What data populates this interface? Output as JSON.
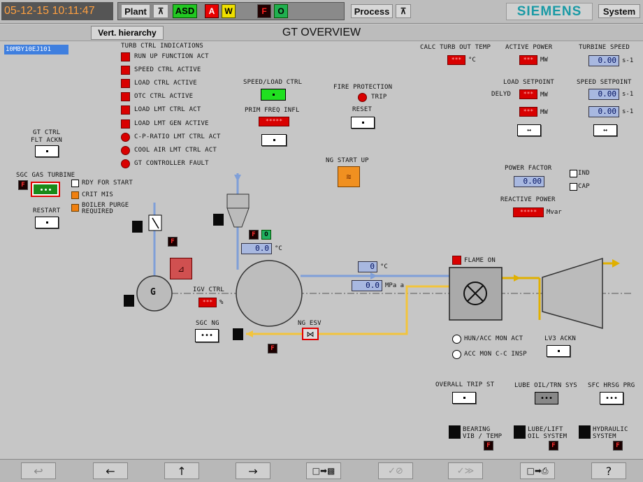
{
  "header": {
    "datetime": "05-12-15 10:11:47",
    "plant": "Plant",
    "asd": "ASD",
    "alarm_a": "A",
    "alarm_w": "W",
    "flag_f": "F",
    "flag_o": "O",
    "process": "Process",
    "brand": "SIEMENS",
    "system": "System"
  },
  "subheader": {
    "vert_hierarchy": "Vert. hierarchy",
    "title": "GT OVERVIEW"
  },
  "tag": "10MBY10EJ101",
  "turb_ctrl": {
    "title": "TURB CTRL INDICATIONS",
    "items": [
      "RUN UP FUNCTION ACT",
      "SPEED CTRL ACTIVE",
      "LOAD CTRL ACTIVE",
      "OTC CTRL ACTIVE",
      "LOAD LMT CTRL ACT",
      "LOAD LMT GEN ACTIVE",
      "C-P-RATIO LMT CTRL ACT",
      "COOL AIR LMT CTRL ACT",
      "GT CONTROLLER FAULT"
    ]
  },
  "gt_ctrl": {
    "line1": "GT CTRL",
    "line2": "FLT ACKN"
  },
  "sgc_gas": {
    "title": "SGC GAS TURBINE",
    "rdy": "RDY FOR START",
    "crit": "CRIT MIS",
    "boiler1": "BOILER PURGE",
    "boiler2": "REQUIRED",
    "restart": "RESTART",
    "f": "F"
  },
  "speed_load": {
    "label": "SPEED/LOAD CTRL",
    "prim": "PRIM FREQ INFL",
    "prim_val": "*****"
  },
  "fire": {
    "label": "FIRE PROTECTION",
    "trip": "TRIP",
    "reset": "RESET"
  },
  "ng_start": {
    "label": "NG START UP"
  },
  "top_right": {
    "calc_label": "CALC TURB OUT TEMP",
    "calc_val": "***",
    "calc_unit": "°C",
    "active_label": "ACTIVE POWER",
    "active_val": "***",
    "active_unit": "MW",
    "speed_label": "TURBINE SPEED",
    "speed_val": "0.00",
    "speed_unit": "s-1",
    "load_sp_label": "LOAD SETPOINT",
    "delyd": "DELYD",
    "load_sp1": "***",
    "load_sp2": "***",
    "mw": "MW",
    "speed_sp_label": "SPEED SETPOINT",
    "speed_sp1": "0.00",
    "speed_sp2": "0.00",
    "s1": "s-1",
    "pf_label": "POWER FACTOR",
    "pf_val": "0.00",
    "ind": "IND",
    "cap": "CAP",
    "react_label": "REACTIVE POWER",
    "react_val": "*****",
    "react_unit": "Mvar"
  },
  "process": {
    "gen": "G",
    "igv": "IGV CTRL",
    "igv_val": "***",
    "igv_unit": "%",
    "comp_temp": "0.0",
    "comp_temp_unit": "°C",
    "air_temp": "0",
    "air_temp_unit": "°C",
    "press": "0.0",
    "press_unit": "MPa a",
    "flame_on": "FLAME ON",
    "sgc_ng": "SGC NG",
    "ng_esv": "NG ESV",
    "f": "F",
    "o": "O"
  },
  "lower_right": {
    "hun": "HUN/ACC MON ACT",
    "acc": "ACC MON C-C INSP",
    "lv3": "LV3 ACKN",
    "overall": "OVERALL TRIP ST",
    "lube": "LUBE OIL/TRN SYS",
    "sfc": "SFC HRSG PRG",
    "bearing1": "BEARING",
    "bearing2": "VIB / TEMP",
    "lube_lift1": "LUBE/LIFT",
    "lube_lift2": "OIL SYSTEM",
    "hydraulic1": "HYDRAULIC",
    "hydraulic2": "SYSTEM",
    "f": "F"
  },
  "footer": {
    "left": "←",
    "up": "↑",
    "right": "→",
    "help": "?"
  },
  "colors": {
    "bg": "#c6c6c6",
    "red": "#d90000",
    "blue_line": "#7f9fd8",
    "yellow_line": "#f2c43c",
    "value_bg": "#a8b8e0"
  }
}
